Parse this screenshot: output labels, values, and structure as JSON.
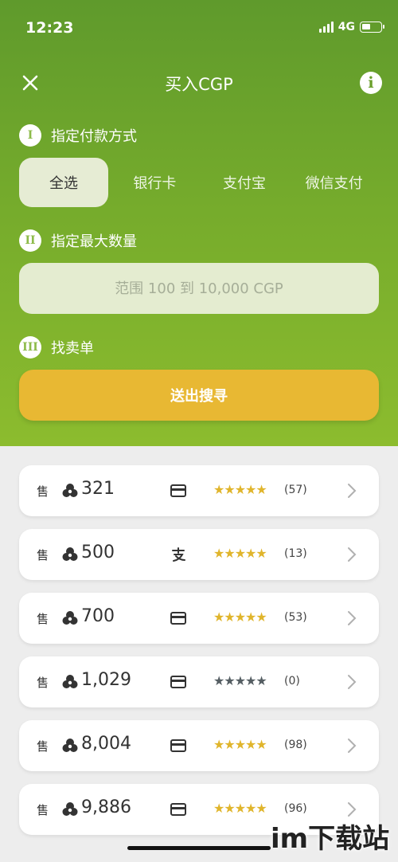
{
  "status_bar": {
    "time": "12:23",
    "network": "4G",
    "battery_level": 0.45
  },
  "header": {
    "title": "买入CGP"
  },
  "steps": [
    {
      "num": "I",
      "label": "指定付款方式"
    },
    {
      "num": "II",
      "label": "指定最大数量"
    },
    {
      "num": "III",
      "label": "找卖单"
    }
  ],
  "payment_tabs": [
    {
      "label": "全选",
      "active": true
    },
    {
      "label": "银行卡",
      "active": false
    },
    {
      "label": "支付宝",
      "active": false
    },
    {
      "label": "微信支付",
      "active": false
    }
  ],
  "amount_input": {
    "placeholder": "范围 100 到 10,000 CGP",
    "value": ""
  },
  "search_button": {
    "label": "送出搜寻"
  },
  "colors": {
    "accent_green": "#7aae2d",
    "button_gold": "#e8b833",
    "star_gold": "#e0b52c",
    "star_gray": "#555e63"
  },
  "orders": [
    {
      "type": "售",
      "amount": "321",
      "pay_method": "card-icon",
      "rating_stars": 5,
      "rated": true,
      "reviews": "(57)"
    },
    {
      "type": "售",
      "amount": "500",
      "pay_method": "alipay-icon",
      "rating_stars": 5,
      "rated": true,
      "reviews": "(13)"
    },
    {
      "type": "售",
      "amount": "700",
      "pay_method": "card-icon",
      "rating_stars": 5,
      "rated": true,
      "reviews": "(53)"
    },
    {
      "type": "售",
      "amount": "1,029",
      "pay_method": "card-icon",
      "rating_stars": 5,
      "rated": false,
      "reviews": "(0)"
    },
    {
      "type": "售",
      "amount": "8,004",
      "pay_method": "card-icon",
      "rating_stars": 5,
      "rated": true,
      "reviews": "(98)"
    },
    {
      "type": "售",
      "amount": "9,886",
      "pay_method": "card-icon",
      "rating_stars": 5,
      "rated": true,
      "reviews": "(96)"
    }
  ],
  "watermark": {
    "text": "im下载站"
  }
}
